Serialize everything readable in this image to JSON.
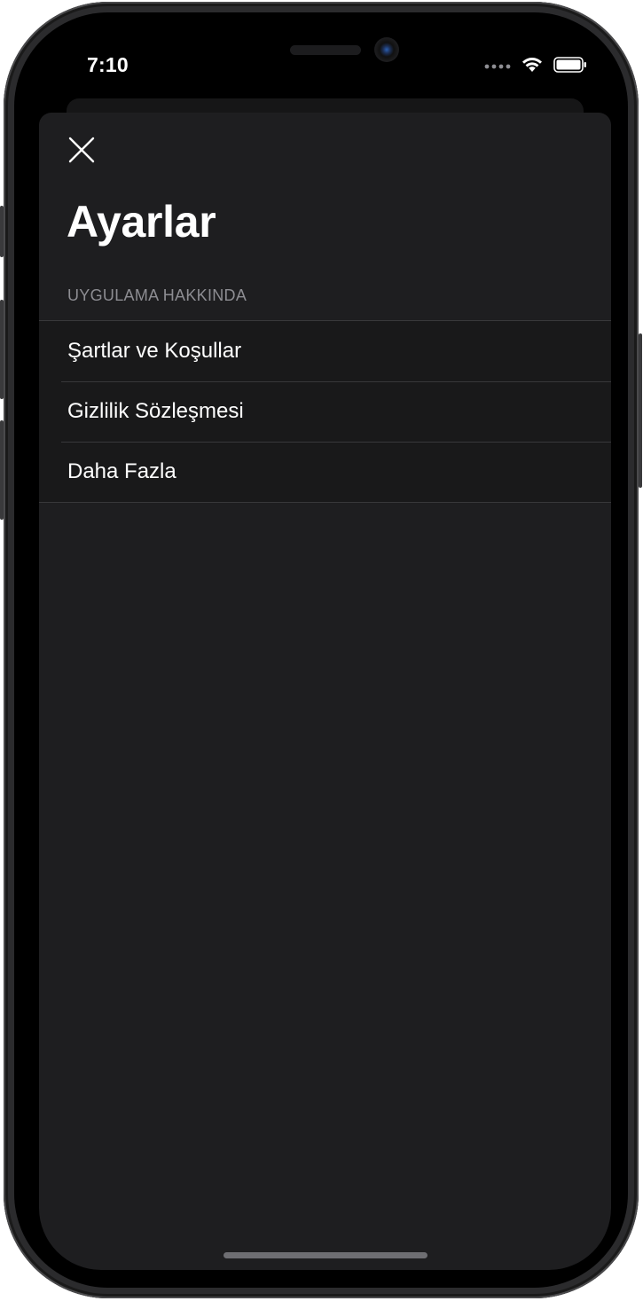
{
  "status_bar": {
    "time": "7:10"
  },
  "settings": {
    "close_icon": "close-icon",
    "title": "Ayarlar",
    "section_header": "UYGULAMA HAKKINDA",
    "items": [
      {
        "label": "Şartlar ve Koşullar"
      },
      {
        "label": "Gizlilik Sözleşmesi"
      },
      {
        "label": "Daha Fazla"
      }
    ]
  },
  "colors": {
    "sheet_background": "#1e1e20",
    "list_background": "#19191a",
    "separator": "#38383a",
    "secondary_text": "#8d8d92",
    "primary_text": "#ffffff"
  }
}
